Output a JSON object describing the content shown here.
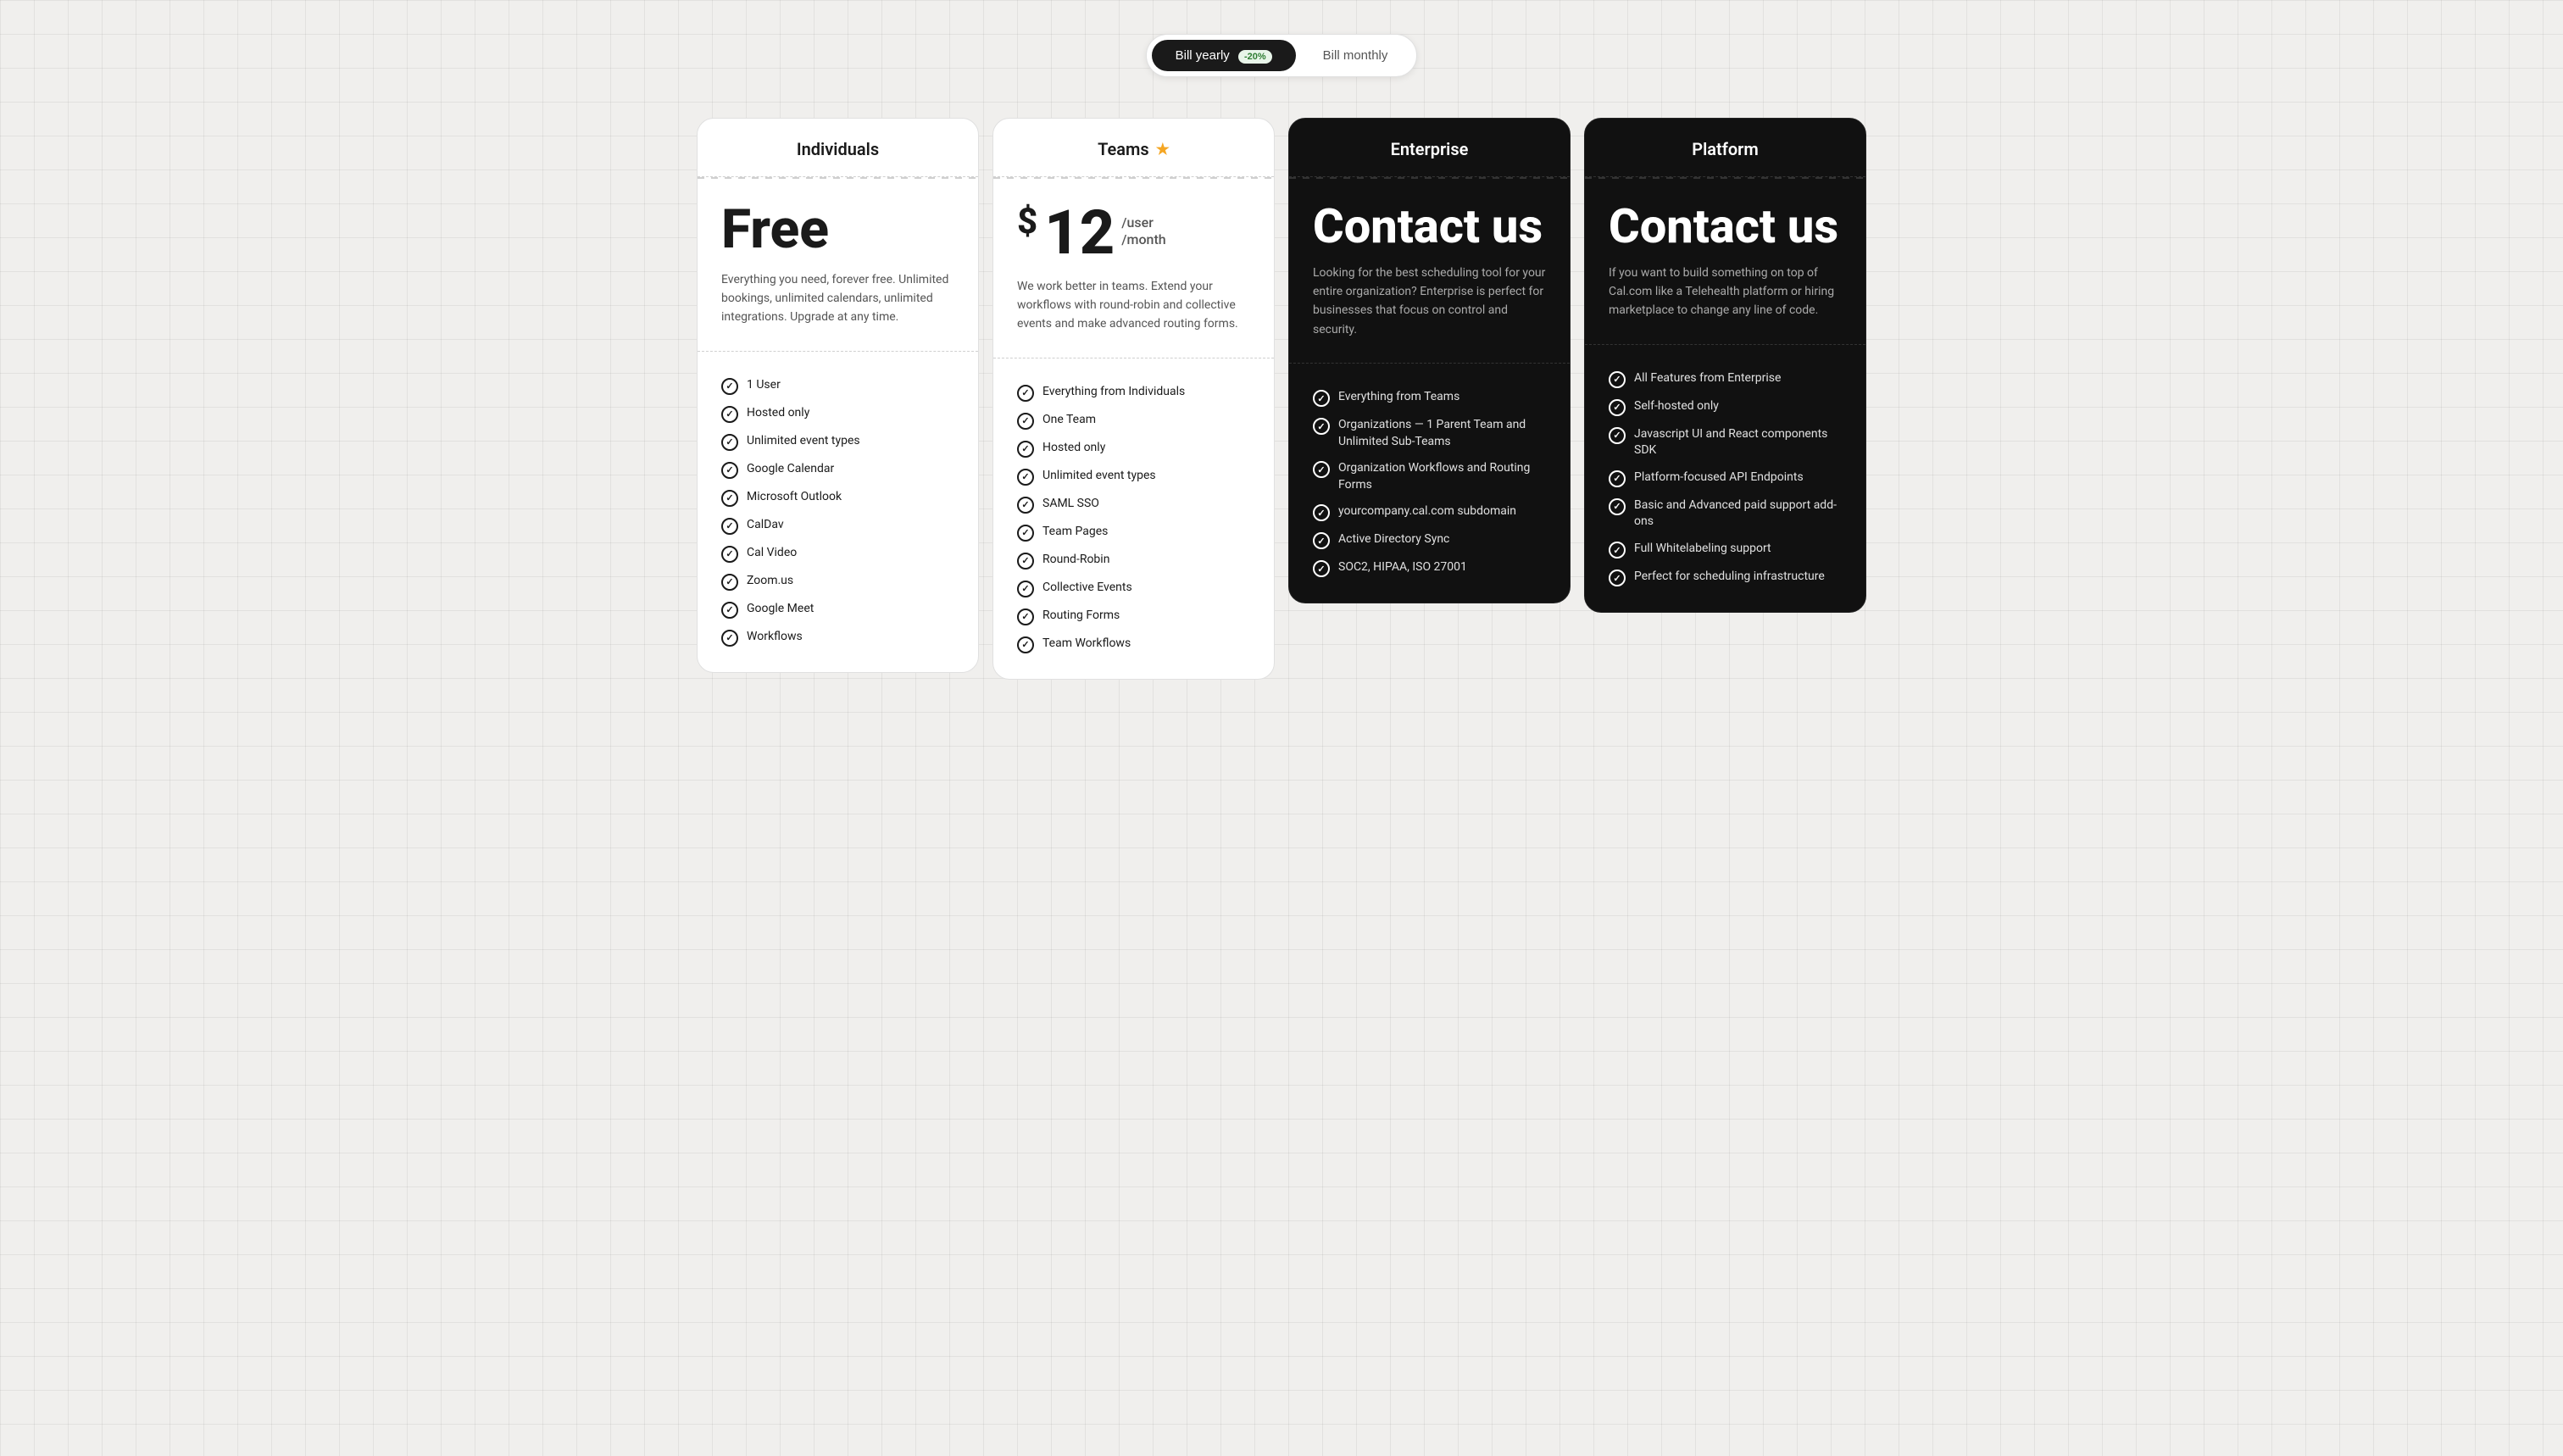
{
  "billing": {
    "yearly_label": "Bill yearly",
    "yearly_discount": "-20%",
    "monthly_label": "Bill monthly",
    "active": "yearly"
  },
  "plans": [
    {
      "id": "individuals",
      "title": "Individuals",
      "star": false,
      "dark": false,
      "price_type": "free",
      "price_free": "Free",
      "description": "Everything you need, forever free. Unlimited bookings, unlimited calendars, unlimited integrations. Upgrade at any time.",
      "features": [
        "1 User",
        "Hosted only",
        "Unlimited event types",
        "Google Calendar",
        "Microsoft Outlook",
        "CalDav",
        "Cal Video",
        "Zoom.us",
        "Google Meet",
        "Workflows"
      ]
    },
    {
      "id": "teams",
      "title": "Teams",
      "star": true,
      "dark": false,
      "price_type": "amount",
      "price_dollar": "$",
      "price_number": "12",
      "price_per_line1": "/user",
      "price_per_line2": "/month",
      "description": "We work better in teams. Extend your workflows with round-robin and collective events and make advanced routing forms.",
      "features": [
        "Everything from Individuals",
        "One Team",
        "Hosted only",
        "Unlimited event types",
        "SAML SSO",
        "Team Pages",
        "Round-Robin",
        "Collective Events",
        "Routing Forms",
        "Team Workflows"
      ]
    },
    {
      "id": "enterprise",
      "title": "Enterprise",
      "star": false,
      "dark": true,
      "price_type": "contact",
      "price_contact": "Contact us",
      "description": "Looking for the best scheduling tool for your entire organization? Enterprise is perfect for businesses that focus on control and security.",
      "features": [
        "Everything from Teams",
        "Organizations — 1 Parent Team and Unlimited Sub-Teams",
        "Organization Workflows and Routing Forms",
        "yourcompany.cal.com subdomain",
        "Active Directory Sync",
        "SOC2, HIPAA, ISO 27001"
      ]
    },
    {
      "id": "platform",
      "title": "Platform",
      "star": false,
      "dark": true,
      "price_type": "contact",
      "price_contact": "Contact us",
      "description": "If you want to build something on top of Cal.com like a Telehealth platform or hiring marketplace to change any line of code.",
      "features": [
        "All Features from Enterprise",
        "Self-hosted only",
        "Javascript UI and React components SDK",
        "Platform-focused API Endpoints",
        "Basic and Advanced paid support add-ons",
        "Full Whitelabeling support",
        "Perfect for scheduling infrastructure"
      ]
    }
  ]
}
